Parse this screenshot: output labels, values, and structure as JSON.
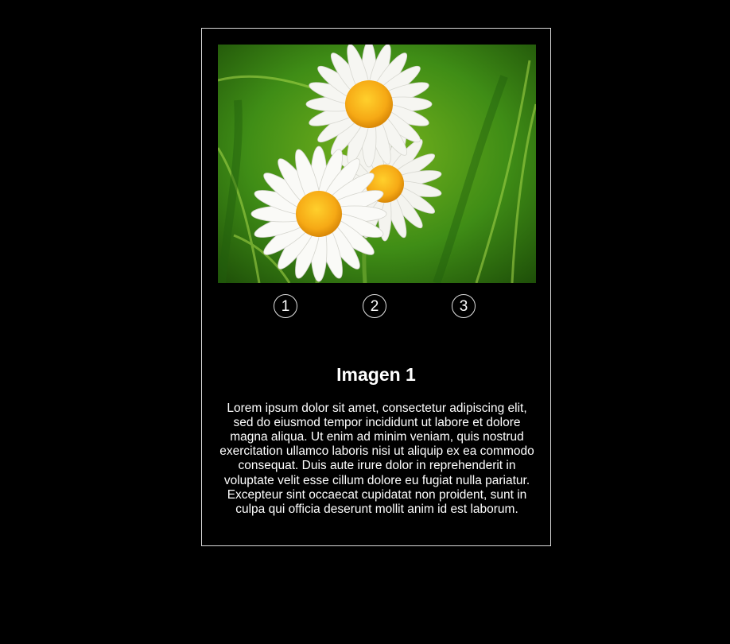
{
  "slider": {
    "image_alt": "Daisy flowers",
    "pages": [
      "1",
      "2",
      "3"
    ],
    "active_page": 1
  },
  "content": {
    "title": "Imagen 1",
    "text": "Lorem ipsum dolor sit amet, consectetur adipiscing elit, sed do eiusmod tempor incididunt ut labore et dolore magna aliqua. Ut enim ad minim veniam, quis nostrud exercitation ullamco laboris nisi ut aliquip ex ea commodo consequat. Duis aute irure dolor in reprehenderit in voluptate velit esse cillum dolore eu fugiat nulla pariatur. Excepteur sint occaecat cupidatat non proident, sunt in culpa qui officia deserunt mollit anim id est laborum."
  },
  "colors": {
    "background": "#000000",
    "card_border": "#d9d9d9",
    "text": "#ffffff",
    "flower_center": "#f6b51e",
    "petal": "#f4f4ef"
  }
}
